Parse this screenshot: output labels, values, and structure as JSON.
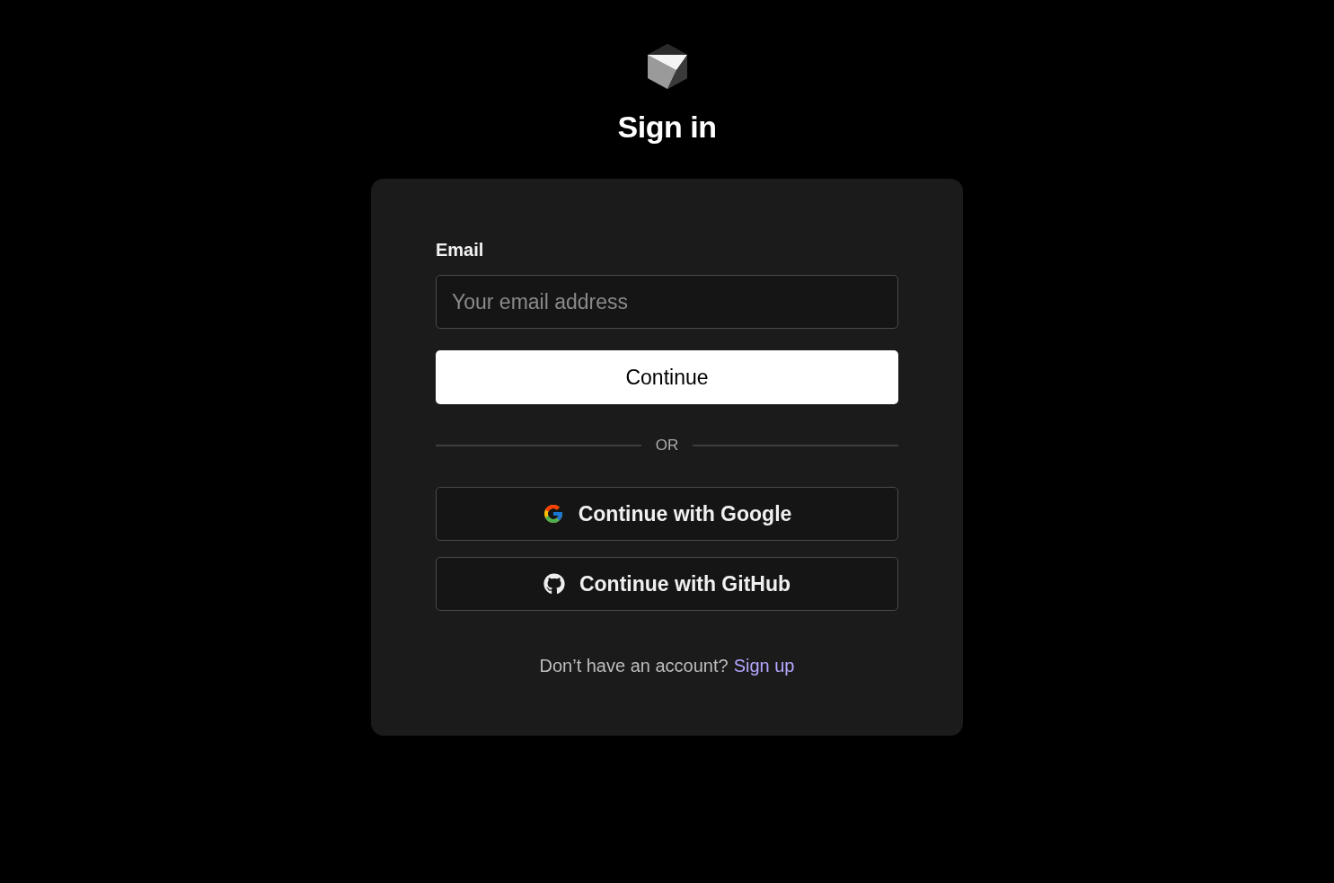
{
  "title": "Sign in",
  "email": {
    "label": "Email",
    "placeholder": "Your email address"
  },
  "continue_button": "Continue",
  "divider": "OR",
  "providers": [
    {
      "kind": "google",
      "label": "Continue with Google"
    },
    {
      "kind": "github",
      "label": "Continue with GitHub"
    }
  ],
  "footer": {
    "text": "Don’t have an account?",
    "link": "Sign up"
  }
}
